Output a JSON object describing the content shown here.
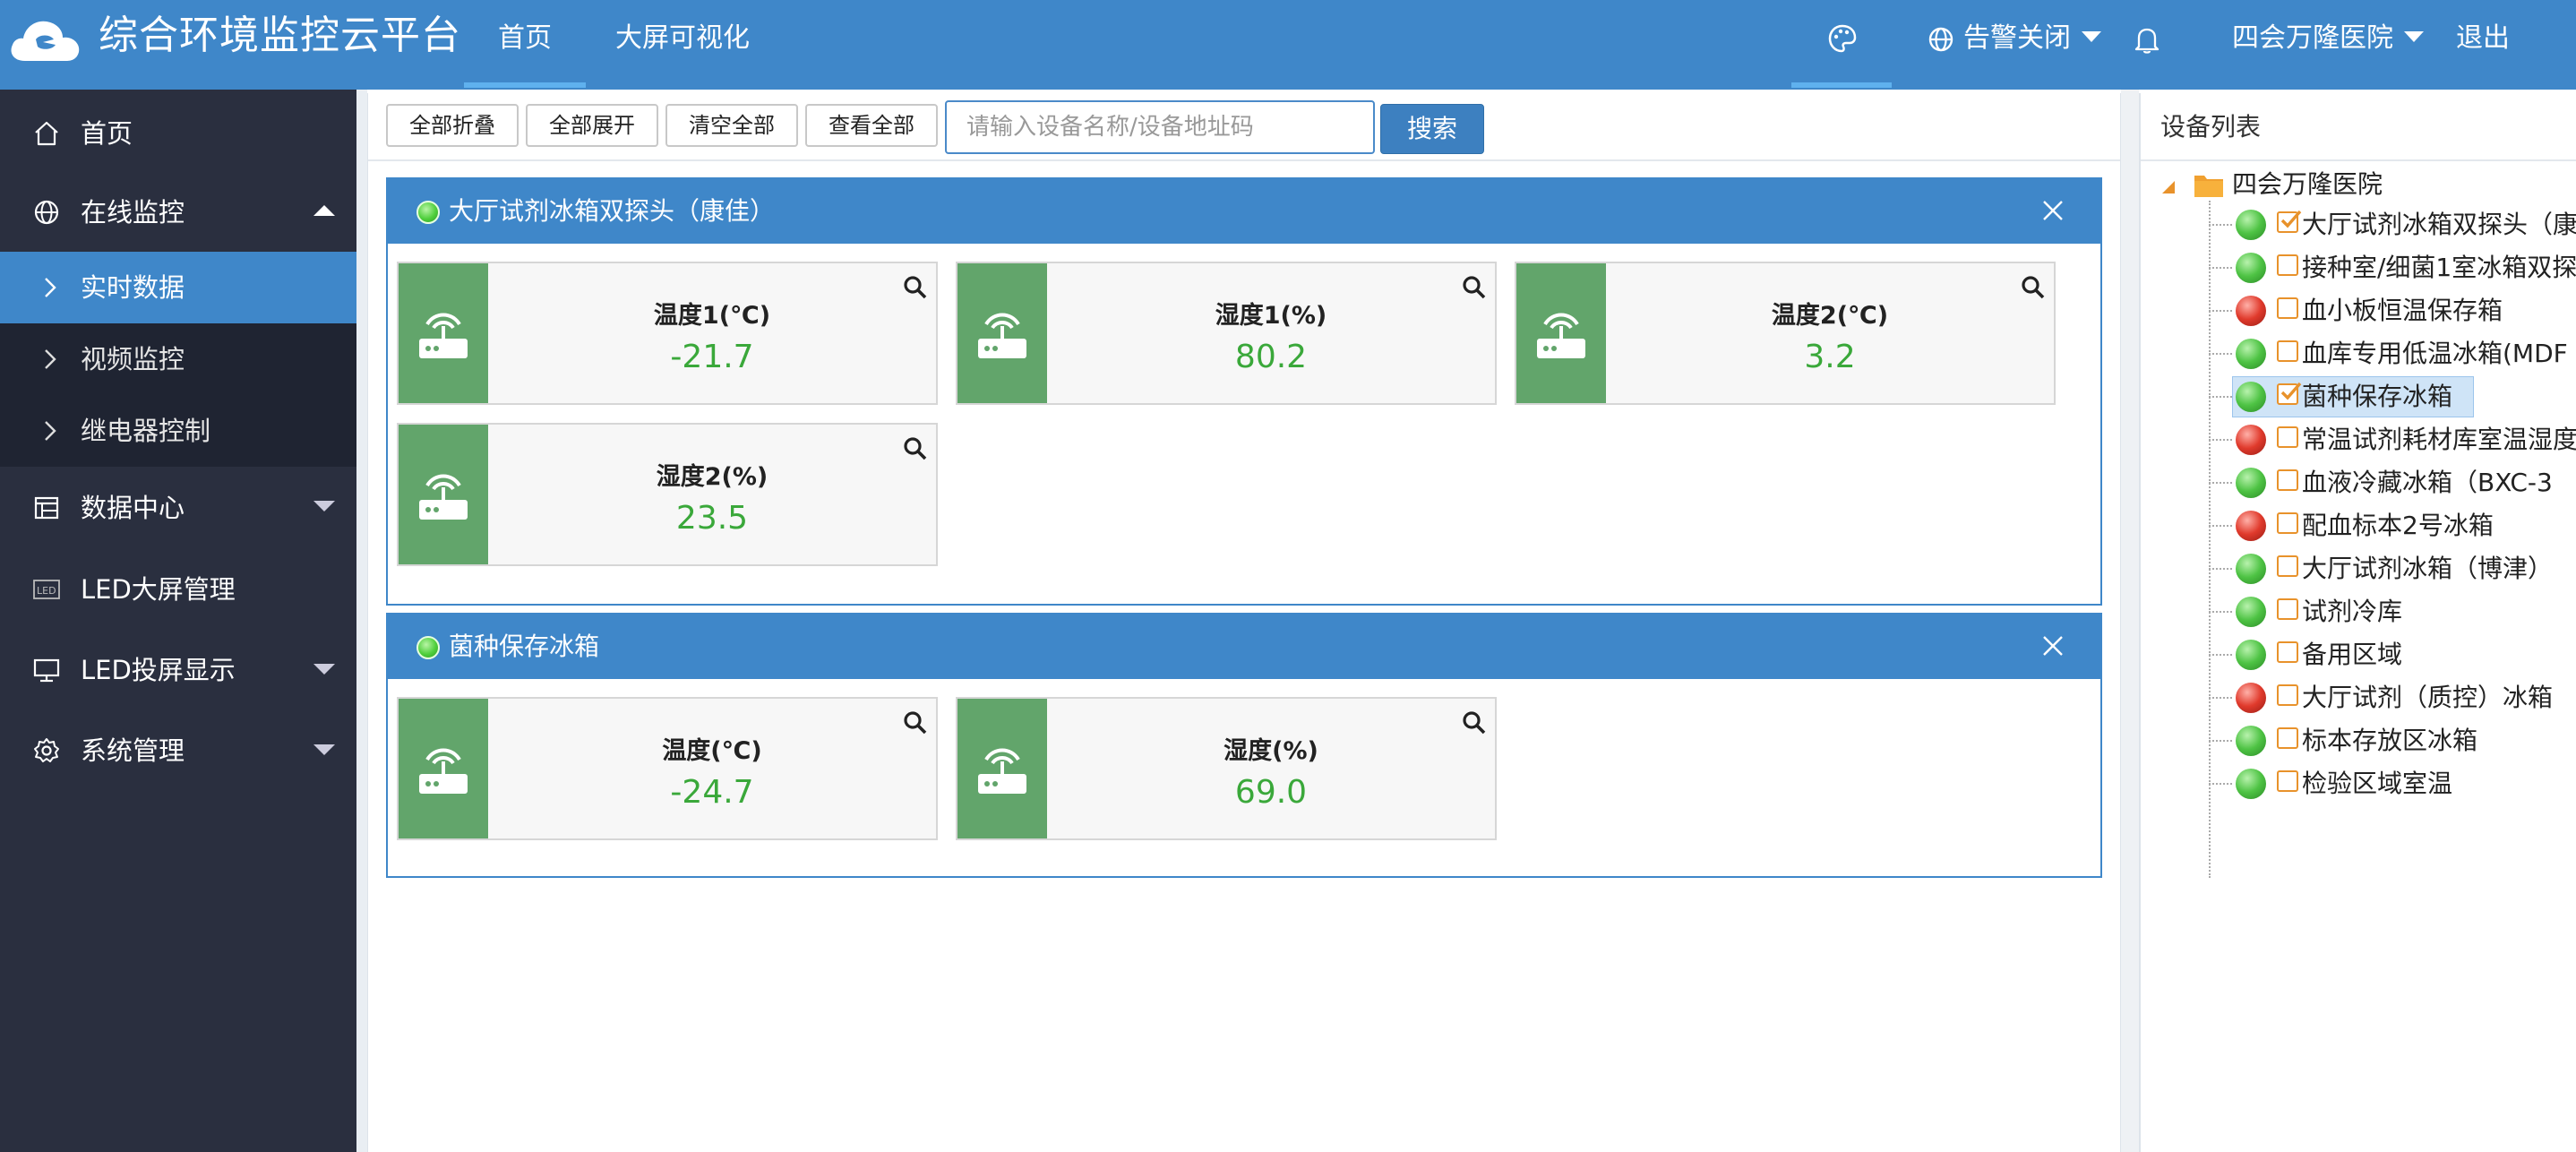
{
  "header": {
    "title": "综合环境监控云平台",
    "nav": [
      {
        "label": "首页",
        "active": true
      },
      {
        "label": "大屏可视化",
        "active": false
      }
    ],
    "alarm_label": "告警关闭",
    "hospital_label": "四会万隆医院",
    "logout_label": "退出",
    "icons": [
      "cloud-logo-icon",
      "palette-icon",
      "globe-icon",
      "bell-icon"
    ]
  },
  "sidebar": {
    "items": [
      {
        "label": "首页",
        "icon": "home-icon"
      },
      {
        "label": "在线监控",
        "icon": "globe-icon",
        "expanded": true,
        "children": [
          {
            "label": "实时数据",
            "active": true
          },
          {
            "label": "视频监控"
          },
          {
            "label": "继电器控制"
          }
        ]
      },
      {
        "label": "数据中心",
        "icon": "table-icon"
      },
      {
        "label": "LED大屏管理",
        "icon": "led-icon"
      },
      {
        "label": "LED投屏显示",
        "icon": "monitor-icon"
      },
      {
        "label": "系统管理",
        "icon": "gear-icon"
      }
    ]
  },
  "toolbar": {
    "collapse_all": "全部折叠",
    "expand_all": "全部展开",
    "clear_all": "清空全部",
    "view_all": "查看全部",
    "search_placeholder": "请输入设备名称/设备地址码",
    "search_value": "",
    "search_label": "搜索"
  },
  "panels": [
    {
      "title": "大厅试剂冰箱双探头（康佳）",
      "status": "online",
      "sensors": [
        {
          "label": "温度1(℃)",
          "value": "-21.7"
        },
        {
          "label": "湿度1(%)",
          "value": "80.2"
        },
        {
          "label": "温度2(℃)",
          "value": "3.2"
        },
        {
          "label": "湿度2(%)",
          "value": "23.5"
        }
      ]
    },
    {
      "title": "菌种保存冰箱",
      "status": "online",
      "sensors": [
        {
          "label": "温度(℃)",
          "value": "-24.7"
        },
        {
          "label": "湿度(%)",
          "value": "69.0"
        }
      ]
    }
  ],
  "device_list": {
    "title": "设备列表",
    "root": "四会万隆医院",
    "devices": [
      {
        "name": "大厅试剂冰箱双探头（康",
        "status": "green",
        "checked": true
      },
      {
        "name": "接种室/细菌1室冰箱双探",
        "status": "green",
        "checked": false
      },
      {
        "name": "血小板恒温保存箱",
        "status": "red",
        "checked": false
      },
      {
        "name": "血库专用低温冰箱(MDF",
        "status": "green",
        "checked": false
      },
      {
        "name": "菌种保存冰箱",
        "status": "green",
        "checked": true,
        "selected": true
      },
      {
        "name": "常温试剂耗材库室温湿度",
        "status": "red",
        "checked": false
      },
      {
        "name": "血液冷藏冰箱（BXC-3",
        "status": "green",
        "checked": false
      },
      {
        "name": "配血标本2号冰箱",
        "status": "red",
        "checked": false
      },
      {
        "name": "大厅试剂冰箱（博津）",
        "status": "green",
        "checked": false
      },
      {
        "name": "试剂冷库",
        "status": "green",
        "checked": false
      },
      {
        "name": "备用区域",
        "status": "green",
        "checked": false
      },
      {
        "name": "大厅试剂（质控）冰箱",
        "status": "red",
        "checked": false
      },
      {
        "name": "标本存放区冰箱",
        "status": "green",
        "checked": false
      },
      {
        "name": "检验区域室温",
        "status": "green",
        "checked": false
      }
    ]
  },
  "colors": {
    "primary": "#3f87c9",
    "sidebar_bg": "#2a2f3f",
    "sensor_icon_bg": "#62a56b",
    "value_green": "#3aa83a",
    "online": "#4ec344",
    "offline": "#e03a2c",
    "checkbox": "#e8922b"
  }
}
